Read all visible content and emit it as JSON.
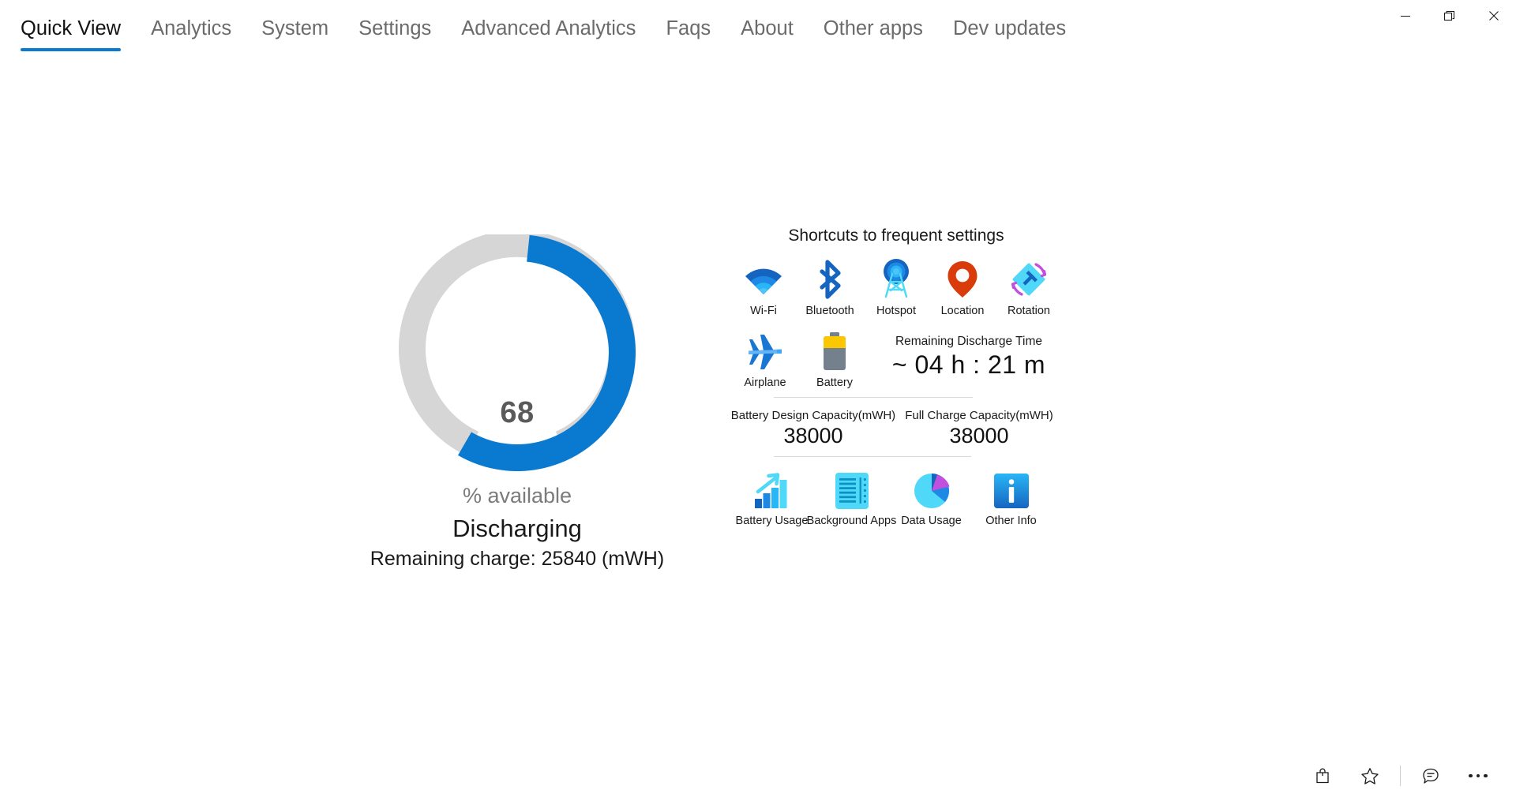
{
  "window": {
    "controls": [
      {
        "name": "minimize",
        "glyph": "minimize-icon"
      },
      {
        "name": "maximize",
        "glyph": "maximize-icon"
      },
      {
        "name": "close",
        "glyph": "close-icon"
      }
    ]
  },
  "tabs": [
    {
      "label": "Quick View",
      "active": true
    },
    {
      "label": "Analytics",
      "active": false
    },
    {
      "label": "System",
      "active": false
    },
    {
      "label": "Settings",
      "active": false
    },
    {
      "label": "Advanced Analytics",
      "active": false
    },
    {
      "label": "Faqs",
      "active": false
    },
    {
      "label": "About",
      "active": false
    },
    {
      "label": "Other apps",
      "active": false
    },
    {
      "label": "Dev updates",
      "active": false
    }
  ],
  "gauge": {
    "percent": 68,
    "percent_text": "68",
    "unit_label": "% available",
    "state": "Discharging",
    "remaining_charge": "Remaining charge: 25840 (mWH)",
    "fill_color": "#0a7ad1",
    "track_color": "#d6d6d6"
  },
  "shortcuts": {
    "title": "Shortcuts to frequent settings",
    "row1": [
      {
        "label": "Wi-Fi",
        "icon": "wifi-icon"
      },
      {
        "label": "Bluetooth",
        "icon": "bluetooth-icon"
      },
      {
        "label": "Hotspot",
        "icon": "hotspot-icon"
      },
      {
        "label": "Location",
        "icon": "location-pin-icon"
      },
      {
        "label": "Rotation",
        "icon": "rotation-lock-icon"
      }
    ],
    "row2": [
      {
        "label": "Airplane",
        "icon": "airplane-icon"
      },
      {
        "label": "Battery",
        "icon": "battery-icon"
      }
    ]
  },
  "discharge": {
    "label": "Remaining Discharge Time",
    "value": "~ 04 h : 21 m"
  },
  "capacities": [
    {
      "label": "Battery Design Capacity(mWH)",
      "value": "38000"
    },
    {
      "label": "Full Charge Capacity(mWH)",
      "value": "38000"
    }
  ],
  "tools": [
    {
      "label": "Battery Usage",
      "icon": "bar-chart-up-icon"
    },
    {
      "label": "Background Apps",
      "icon": "list-document-icon"
    },
    {
      "label": "Data Usage",
      "icon": "pie-chart-icon"
    },
    {
      "label": "Other Info",
      "icon": "info-icon"
    }
  ],
  "bottombar": [
    {
      "name": "shopping-bag-icon"
    },
    {
      "name": "favorite-star-icon"
    },
    {
      "name": "separator"
    },
    {
      "name": "feedback-chat-icon"
    },
    {
      "name": "more-options-icon"
    }
  ]
}
